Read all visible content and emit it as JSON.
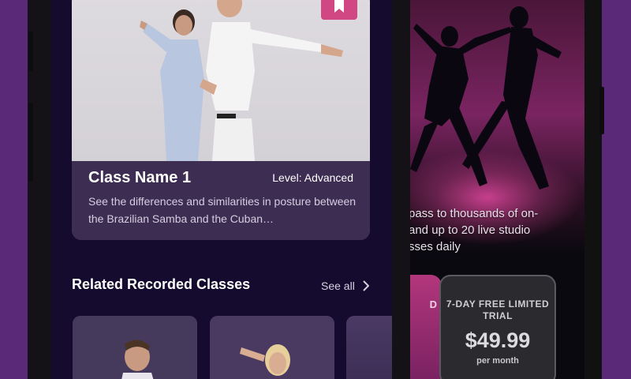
{
  "featured_class": {
    "name": "Class Name 1",
    "level": "Level: Advanced",
    "description": "See the differences and similarities in posture between the Brazilian Samba and the Cuban…",
    "bookmark_icon": "bookmark-icon"
  },
  "related": {
    "title": "Related Recorded Classes",
    "see_all": "See all",
    "chevron_icon": "chevron-right-icon"
  },
  "background_screen": {
    "promo_text": "pass to thousands of on- and up to 20 live studio sses daily",
    "promo_lines": [
      "pass to thousands of on-",
      "and up to 20 live studio",
      "sses daily"
    ],
    "partial_card_label": "D",
    "plan": {
      "title": "7-DAY FREE LIMITED TRIAL",
      "price": "$49.99",
      "period": "per month"
    }
  },
  "colors": {
    "page_background": "#5a2a78",
    "screen_background": "#140b2e",
    "card_background": "#3e2d52",
    "accent_pink": "#d04783"
  }
}
